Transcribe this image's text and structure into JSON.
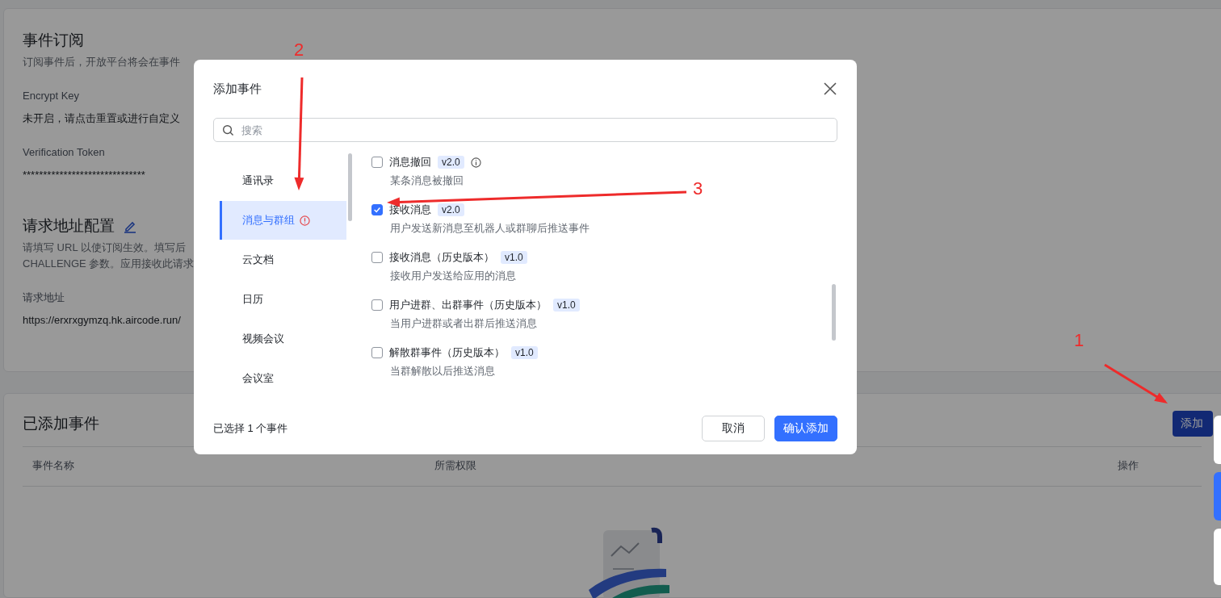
{
  "subscription": {
    "title": "事件订阅",
    "intro": "订阅事件后，开放平台将会在事件",
    "fields": [
      {
        "label": "Encrypt Key",
        "value": "未开启，请点击重置或进行自定义"
      },
      {
        "label": "Verification Token",
        "value": "******************************"
      }
    ]
  },
  "request_config": {
    "title": "请求地址配置",
    "desc_lines": [
      "请填写 URL 以使订阅生效。填写后",
      "CHALLENGE 参数。应用接收此请求"
    ],
    "url_label": "请求地址",
    "url": "https://erxrxgymzq.hk.aircode.run/"
  },
  "added_events": {
    "title": "已添加事件",
    "add_button": "添加",
    "columns": [
      "事件名称",
      "所需权限",
      "操作"
    ]
  },
  "dialog": {
    "title": "添加事件",
    "search": {
      "placeholder": "搜索"
    },
    "categories": [
      {
        "label": "通讯录",
        "selected": false,
        "alert": false
      },
      {
        "label": "消息与群组",
        "selected": true,
        "alert": true
      },
      {
        "label": "云文档",
        "selected": false,
        "alert": false
      },
      {
        "label": "日历",
        "selected": false,
        "alert": false
      },
      {
        "label": "视频会议",
        "selected": false,
        "alert": false
      },
      {
        "label": "会议室",
        "selected": false,
        "alert": false
      }
    ],
    "events": [
      {
        "name": "消息撤回",
        "version": "v2.0",
        "info": true,
        "checked": false,
        "desc": "某条消息被撤回"
      },
      {
        "name": "接收消息",
        "version": "v2.0",
        "checked": true,
        "desc": "用户发送新消息至机器人或群聊后推送事件"
      },
      {
        "name": "接收消息（历史版本）",
        "version": "v1.0",
        "checked": false,
        "desc": "接收用户发送给应用的消息"
      },
      {
        "name": "用户进群、出群事件（历史版本）",
        "version": "v1.0",
        "checked": false,
        "desc": "当用户进群或者出群后推送消息"
      },
      {
        "name": "解散群事件（历史版本）",
        "version": "v1.0",
        "checked": false,
        "desc": "当群解散以后推送消息"
      }
    ],
    "selection_summary": "已选择 1 个事件",
    "buttons": [
      "取消",
      "确认添加"
    ]
  },
  "annotations": [
    {
      "label": "1"
    },
    {
      "label": "2"
    },
    {
      "label": "3"
    }
  ]
}
